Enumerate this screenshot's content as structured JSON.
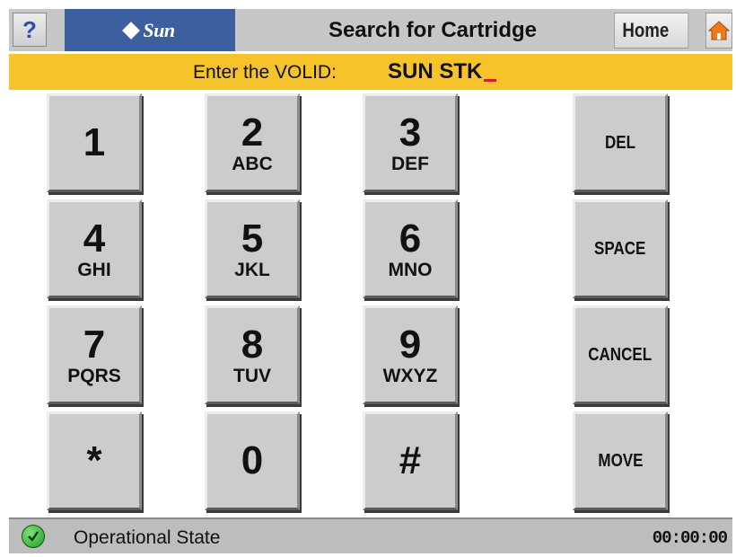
{
  "header": {
    "help_label": "?",
    "logo_text": "Sun",
    "title": "Search for Cartridge",
    "home_label": "Home",
    "home_icon": "house-icon"
  },
  "entry": {
    "label": "Enter the VOLID:",
    "value": "SUN STK",
    "cursor_color": "#d61f1f"
  },
  "keypad": {
    "digits": [
      {
        "main": "1",
        "sub": ""
      },
      {
        "main": "2",
        "sub": "ABC"
      },
      {
        "main": "3",
        "sub": "DEF"
      },
      {
        "main": "4",
        "sub": "GHI"
      },
      {
        "main": "5",
        "sub": "JKL"
      },
      {
        "main": "6",
        "sub": "MNO"
      },
      {
        "main": "7",
        "sub": "PQRS"
      },
      {
        "main": "8",
        "sub": "TUV"
      },
      {
        "main": "9",
        "sub": "WXYZ"
      },
      {
        "main": "*",
        "sub": ""
      },
      {
        "main": "0",
        "sub": ""
      },
      {
        "main": "#",
        "sub": ""
      }
    ],
    "functions": [
      "DEL",
      "SPACE",
      "CANCEL",
      "MOVE"
    ]
  },
  "status": {
    "text": "Operational State",
    "icon": "check-circle-icon",
    "clock": "00:00:00"
  },
  "colors": {
    "entry_bar": "#f6c32a",
    "logo_bg": "#3c5fa0",
    "key_face": "#cccccc",
    "status_ok": "#1f9e1f"
  }
}
